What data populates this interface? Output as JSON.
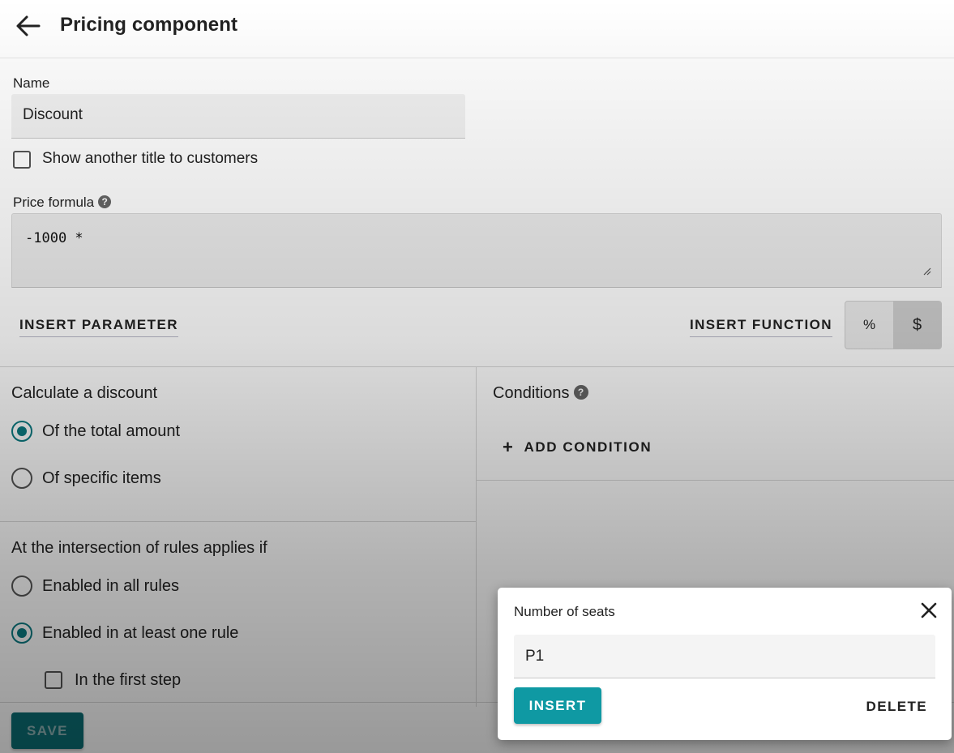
{
  "header": {
    "title": "Pricing component"
  },
  "form": {
    "name_label": "Name",
    "name_value": "Discount",
    "show_title_label": "Show another title to customers",
    "price_formula_label": "Price formula",
    "help_glyph": "?",
    "formula_value": "-1000 *",
    "insert_parameter_label": "INSERT PARAMETER",
    "insert_function_label": "INSERT FUNCTION",
    "unit_toggle": {
      "percent_label": "%",
      "dollar_label": "$",
      "selected": "$"
    }
  },
  "discount": {
    "title": "Calculate a discount",
    "options": [
      {
        "label": "Of the total amount",
        "checked": true
      },
      {
        "label": "Of specific items",
        "checked": false
      }
    ]
  },
  "intersection": {
    "title": "At the intersection of rules applies if",
    "options": [
      {
        "label": "Enabled in all rules",
        "checked": false
      },
      {
        "label": "Enabled in at least one rule",
        "checked": true
      }
    ],
    "first_step_label": "In the first step"
  },
  "conditions": {
    "title": "Conditions",
    "add_condition_label": "ADD CONDITION"
  },
  "footer": {
    "save_label": "SAVE"
  },
  "popover": {
    "title": "Number of seats",
    "input_value": "P1",
    "insert_label": "INSERT",
    "delete_label": "DELETE"
  },
  "colors": {
    "accent": "#0f99a3",
    "radio_checked": "#0b7b82"
  }
}
